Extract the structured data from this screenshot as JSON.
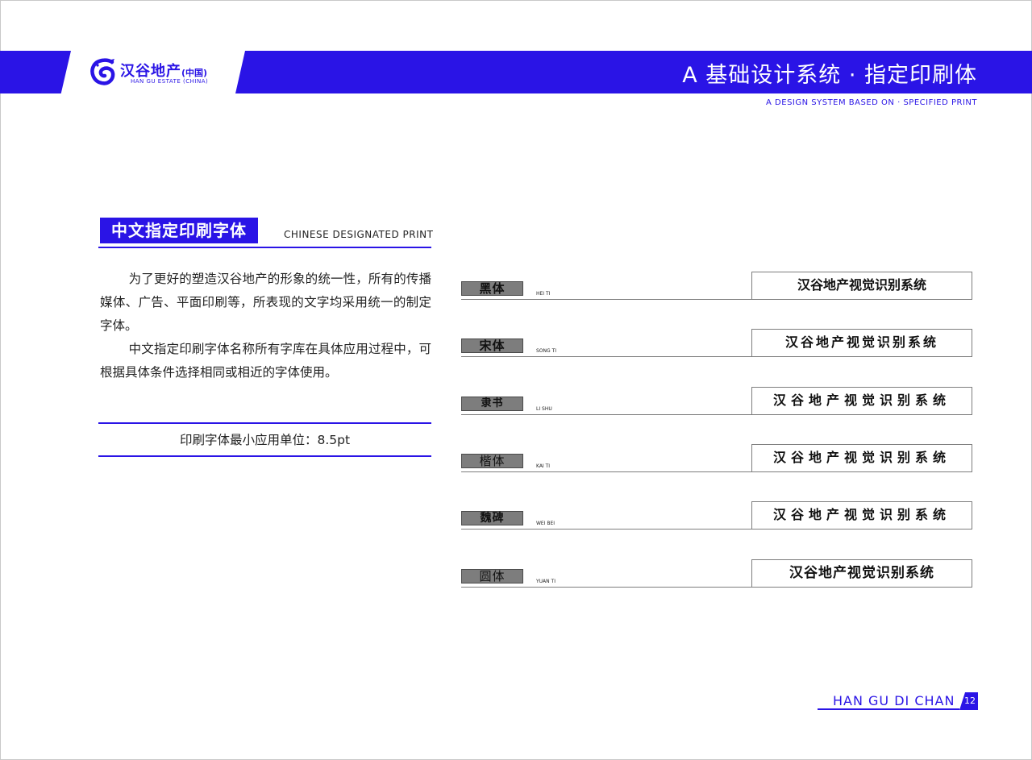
{
  "brand": {
    "name_cn": "汉谷地产",
    "name_cn_suffix": "(中国)",
    "name_en": "HAN GU ESTATE (CHINA)",
    "color": "#2a14e6"
  },
  "header": {
    "title": "A 基础设计系统 · 指定印刷体",
    "subtitle": "A DESIGN SYSTEM BASED ON · SPECIFIED PRINT"
  },
  "section": {
    "label": "中文指定印刷字体",
    "label_en": "CHINESE DESIGNATED PRINT",
    "paragraph1": "为了更好的塑造汉谷地产的形象的统一性，所有的传播媒体、广告、平面印刷等，所表现的文字均采用统一的制定字体。",
    "paragraph2": "中文指定印刷字体名称所有字库在具体应用过程中，可根据具体条件选择相同或相近的字体使用。",
    "min_unit": "印刷字体最小应用单位：8.5pt"
  },
  "fonts": [
    {
      "name": "黑体",
      "en": "HEI TI",
      "sample": "汉谷地产视觉识别系统"
    },
    {
      "name": "宋体",
      "en": "SONG TI",
      "sample": "汉谷地产视觉识别系统"
    },
    {
      "name": "隶书",
      "en": "LI SHU",
      "sample": "汉谷地产视觉识别系统"
    },
    {
      "name": "楷体",
      "en": "KAI TI",
      "sample": "汉谷地产视觉识别系统"
    },
    {
      "name": "魏碑",
      "en": "WEI BEI",
      "sample": "汉谷地产视觉识别系统"
    },
    {
      "name": "圆体",
      "en": "YUAN TI",
      "sample": "汉谷地产视觉识别系统"
    }
  ],
  "footer": {
    "text": "HAN GU DI CHAN",
    "page": "12"
  },
  "icons": {
    "logo": "dragon-logo-icon"
  }
}
